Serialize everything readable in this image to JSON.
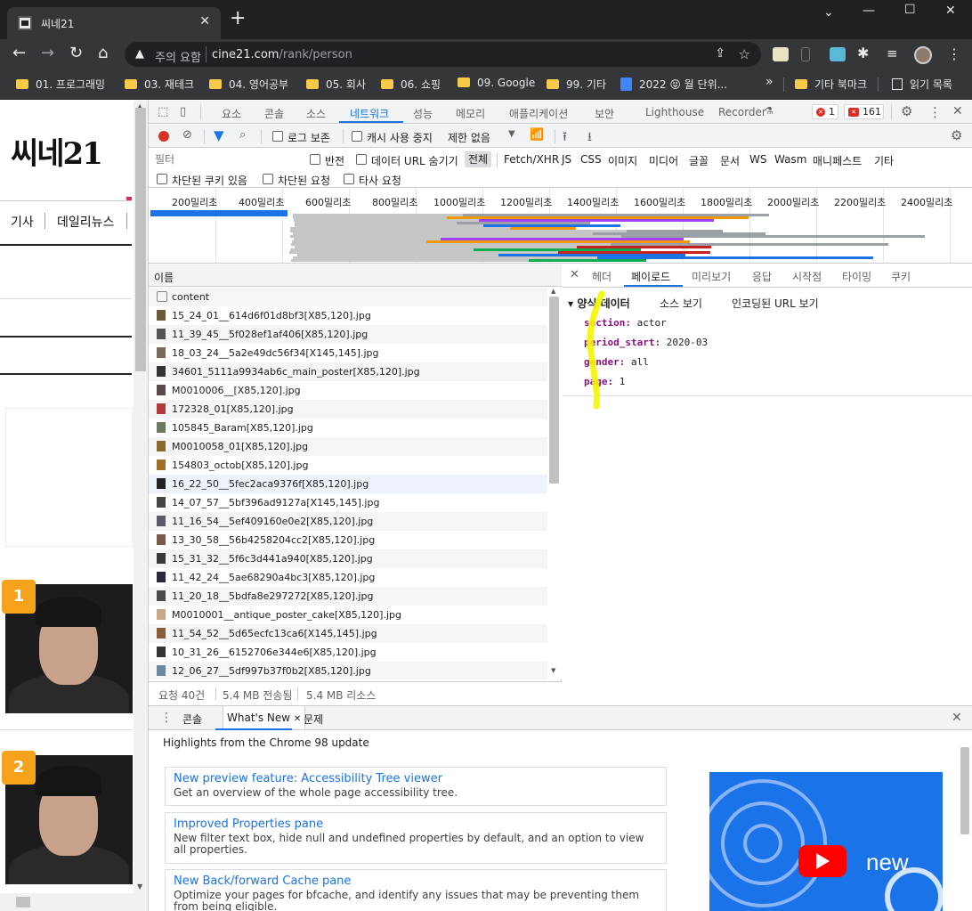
{
  "browser": {
    "tab_title": "씨네21",
    "address": {
      "security_label": "주의 요함",
      "url_host": "cine21.com",
      "url_path": "/rank/person"
    },
    "bookmarks": [
      "01. 프로그래밍",
      "03. 재테크",
      "04. 영어공부",
      "05. 회사",
      "06. 쇼핑",
      "09. Google",
      "99. 기타",
      "2022 😝 월 단위...",
      "»",
      "기타 북마크",
      "읽기 목록"
    ]
  },
  "site": {
    "logo": "씨네21",
    "nav": [
      "기사",
      "데일리뉴스"
    ],
    "rank_badges": [
      "1",
      "2"
    ]
  },
  "devtools": {
    "main_tabs": [
      "요소",
      "콘솔",
      "소스",
      "네트워크",
      "성능",
      "메모리",
      "애플리케이션",
      "보안",
      "Lighthouse",
      "Recorder"
    ],
    "error_count": "1",
    "warning_count": "161",
    "toolbar": {
      "preserve_log": "로그 보존",
      "disable_cache": "캐시 사용 중지",
      "throttle": "제한 없음"
    },
    "filter": {
      "placeholder": "필터",
      "invert": "반전",
      "hide_data_urls": "데이터 URL 숨기기",
      "all": "전체",
      "types": [
        "Fetch/XHR",
        "JS",
        "CSS",
        "이미지",
        "미디어",
        "글꼴",
        "문서",
        "WS",
        "Wasm",
        "매니페스트",
        "기타"
      ],
      "blocked_cookies": "차단된 쿠키 있음",
      "blocked_requests": "차단된 요청",
      "third_party": "타사 요청"
    },
    "timeline_labels": [
      "200밀리초",
      "400밀리초",
      "600밀리초",
      "800밀리초",
      "1000밀리초",
      "1200밀리초",
      "1400밀리초",
      "1600밀리초",
      "1800밀리초",
      "2000밀리초",
      "2200밀리초",
      "2400밀리초"
    ],
    "requests": {
      "column_name": "이름",
      "rows": [
        "content",
        "15_24_01__614d6f01d8bf3[X85,120].jpg",
        "11_39_45__5f028ef1af406[X85,120].jpg",
        "18_03_24__5a2e49dc56f34[X145,145].jpg",
        "34601_5111a9934ab6c_main_poster[X85,120].jpg",
        "M0010006__[X85,120].jpg",
        "172328_01[X85,120].jpg",
        "105845_Baram[X85,120].jpg",
        "M0010058_01[X85,120].jpg",
        "154803_octob[X85,120].jpg",
        "16_22_50__5fec2aca9376f[X85,120].jpg",
        "14_07_57__5bf396ad9127a[X145,145].jpg",
        "11_16_54__5ef409160e0e2[X85,120].jpg",
        "13_30_58__56b4258204cc2[X85,120].jpg",
        "15_31_32__5f6c3d441a940[X85,120].jpg",
        "11_42_24__5ae68290a4bc3[X85,120].jpg",
        "11_20_18__5bdfa8e297272[X85,120].jpg",
        "M0010001__antique_poster_cake[X85,120].jpg",
        "11_54_52__5d65ecfc13ca6[X145,145].jpg",
        "10_31_26__6152706e344e6[X85,120].jpg",
        "12_06_27__5df997b37f0b2[X85,120].jpg"
      ],
      "status": {
        "count": "요청 40건",
        "transferred": "5.4 MB 전송됨",
        "resources": "5.4 MB 리소스"
      }
    },
    "detail": {
      "tabs": [
        "헤더",
        "페이로드",
        "미리보기",
        "응답",
        "시작점",
        "타이밍",
        "쿠키"
      ],
      "section_title": "양식 데이터",
      "view_source": "소스 보기",
      "view_url_encoded": "인코딩된 URL 보기",
      "form_data": [
        {
          "key": "section:",
          "value": "actor"
        },
        {
          "key": "period_start:",
          "value": "2020-03"
        },
        {
          "key": "gender:",
          "value": "all"
        },
        {
          "key": "page:",
          "value": "1"
        }
      ]
    },
    "drawer": {
      "tabs": [
        "콘솔",
        "What's New",
        "문제"
      ],
      "headline": "Highlights from the Chrome 98 update",
      "cards": [
        {
          "title": "New preview feature: Accessibility Tree viewer",
          "desc": "Get an overview of the whole page accessibility tree."
        },
        {
          "title": "Improved Properties pane",
          "desc": "New filter text box, hide null and undefined properties by default, and an option to view all properties."
        },
        {
          "title": "New Back/forward Cache pane",
          "desc": "Optimize your pages for bfcache, and identify any issues that may be preventing them from being eligible."
        }
      ],
      "video_text": "new"
    }
  }
}
